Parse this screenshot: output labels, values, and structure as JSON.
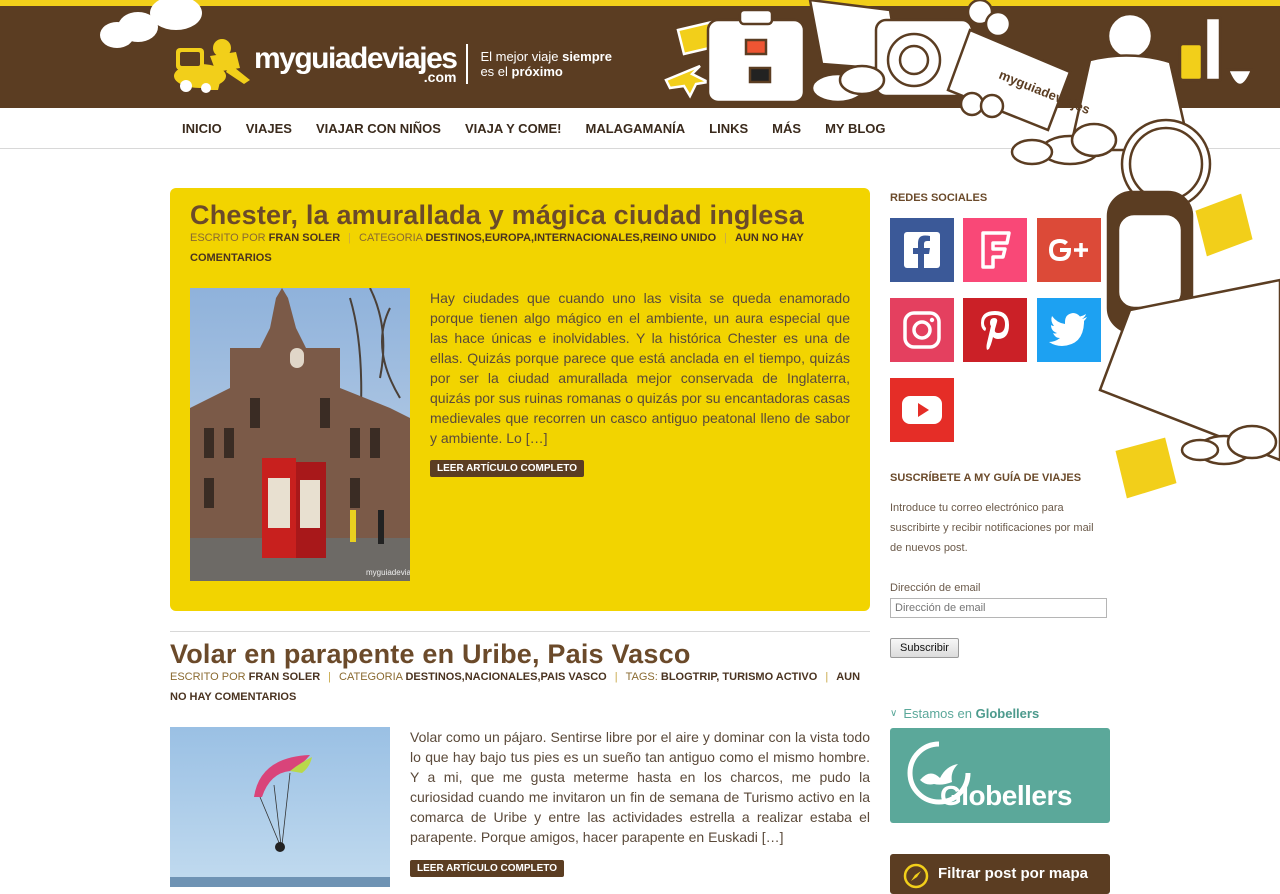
{
  "brand": {
    "name": "myguiadeviajes",
    "domain": ".com",
    "tagline_1a": "El mejor viaje ",
    "tagline_1b": "siempre",
    "tagline_2a": "es el ",
    "tagline_2b": "próximo",
    "deco_label": "myguiadeviajes"
  },
  "nav": [
    "INICIO",
    "VIAJES",
    "VIAJAR CON NIÑOS",
    "VIAJA Y COME!",
    "MALAGAMANÍA",
    "LINKS",
    "MÁS",
    "MY BLOG"
  ],
  "posts": [
    {
      "title": "Chester, la amurallada y mágica ciudad inglesa",
      "written_by_label": "ESCRITO POR",
      "author": "FRAN SOLER",
      "category_label": "CATEGORIA",
      "categories": "DESTINOS,EUROPA,INTERNACIONALES,REINO UNIDO",
      "comments": "AUN NO HAY COMENTARIOS",
      "excerpt": "Hay ciudades que cuando uno las visita se queda enamorado porque tienen algo mágico en el ambiente, un aura especial que las hace únicas e inolvidables. Y la histórica Chester es una de ellas. Quizás porque parece que está anclada en el tiempo, quizás por ser la ciudad amurallada mejor conservada de Inglaterra, quizás por sus ruinas romanas o quizás por su encantadoras casas medievales que recorren un casco antiguo peatonal lleno de sabor y ambiente. Lo […]",
      "read_more": "LEER ARTÍCULO COMPLETO",
      "photo_watermark": "myguiadeviajes"
    },
    {
      "title": "Volar en parapente en Uribe, Pais Vasco",
      "written_by_label": "ESCRITO POR",
      "author": "FRAN SOLER",
      "category_label": "CATEGORIA",
      "categories": "DESTINOS,NACIONALES,PAIS VASCO",
      "tags_label": "TAGS:",
      "tags": "BLOGTRIP, TURISMO ACTIVO",
      "comments_a": "AUN",
      "comments_b": "NO HAY COMENTARIOS",
      "excerpt": "Volar como un pájaro. Sentirse libre por el aire y dominar con la vista todo lo que hay bajo tus pies es un sueño tan antiguo como el mismo hombre. Y a mi, que me gusta meterme hasta en los charcos, me pudo la curiosidad cuando me invitaron un fin de semana de Turismo activo en la comarca de Uribe y entre las actividades estrella a realizar estaba el parapente. Porque amigos, hacer parapente en Euskadi […]",
      "read_more": "LEER ARTÍCULO COMPLETO"
    }
  ],
  "sidebar": {
    "social_title": "REDES SOCIALES",
    "social": [
      {
        "icon": "facebook-icon",
        "color": "#3b5998"
      },
      {
        "icon": "foursquare-icon",
        "color": "#f94877"
      },
      {
        "icon": "google-plus-icon",
        "color": "#dc4a38"
      },
      {
        "icon": "instagram-icon",
        "color": "#e4405f"
      },
      {
        "icon": "pinterest-icon",
        "color": "#cb2027"
      },
      {
        "icon": "twitter-icon",
        "color": "#1da1f2"
      },
      {
        "icon": "youtube-icon",
        "color": "#e52d27"
      }
    ],
    "subscribe_title": "SUSCRÍBETE A MY GUÍA DE VIAJES",
    "subscribe_text": "Introduce tu correo electrónico para suscribirte y recibir notificaciones por mail de nuevos post.",
    "email_label": "Dirección de email",
    "email_placeholder": "Dirección de email",
    "subscribe_button": "Subscribir",
    "globellers_prefix": "Estamos en ",
    "globellers_bold": "Globellers",
    "globellers_logo": "Globellers",
    "globellers_color": "#5ba89a",
    "map_filter": "Filtrar post por mapa"
  }
}
